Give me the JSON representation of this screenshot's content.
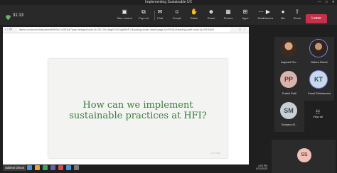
{
  "window": {
    "title": "Implementing Sustainable UX",
    "controls": [
      "—",
      "□",
      "✕"
    ]
  },
  "toolbar": {
    "timer": "31:13",
    "buttons": [
      {
        "label": "Take control",
        "icon": "▣"
      },
      {
        "label": "Pop out",
        "icon": "⧉"
      },
      {
        "label": "Chat",
        "icon": "✉"
      },
      {
        "label": "People",
        "icon": "☺"
      },
      {
        "label": "Raise",
        "icon": "✋"
      },
      {
        "label": "React",
        "icon": "☻"
      },
      {
        "label": "Rooms",
        "icon": "▦"
      },
      {
        "label": "Apps",
        "icon": "⊞"
      },
      {
        "label": "More",
        "icon": "⋯"
      },
      {
        "label": "Camera",
        "icon": "▶"
      },
      {
        "label": "Mic",
        "icon": "●"
      },
      {
        "label": "Share",
        "icon": "⇧"
      }
    ],
    "leave_label": "Leave"
  },
  "browser": {
    "url": "figma.com/proto/d4kyodmn5t0l8Shc?c2f53c67type=design&node-id=201-2&t=8vgB19310jrybBvP-0&scaling=scale-down&page-id=0%3A1&starting-point-node-id=201%3A2"
  },
  "slide": {
    "heading_line1": "How can we implement",
    "heading_line2": "sustainable practices at HFI?",
    "watermark": "UXIndia"
  },
  "presenter": {
    "name": "Sabnoi Dhoot"
  },
  "participants": [
    {
      "name": "Aayushi Ra...",
      "initials": "",
      "photo": true
    },
    {
      "name": "Sabira Dhoot",
      "initials": "",
      "photo": true
    },
    {
      "name": "Prafull Patil",
      "initials": "PP",
      "photo": false
    },
    {
      "name": "Kunal Tahilramani",
      "initials": "KT",
      "photo": false
    },
    {
      "name": "Sanjana M...",
      "initials": "SM",
      "photo": false
    }
  ],
  "view_all_label": "View all",
  "self": {
    "initials": "SS"
  },
  "tray": {
    "time": "4:04 PM",
    "date": "8/21/2023"
  },
  "colors": {
    "leave": "#c4314b",
    "slide_heading": "#3a7d3a",
    "avatar_pp": "#d8b4ac",
    "avatar_kt": "#c9d9ec",
    "avatar_sm": "#c8cfd4",
    "avatar_ss": "#f0c1b8"
  }
}
